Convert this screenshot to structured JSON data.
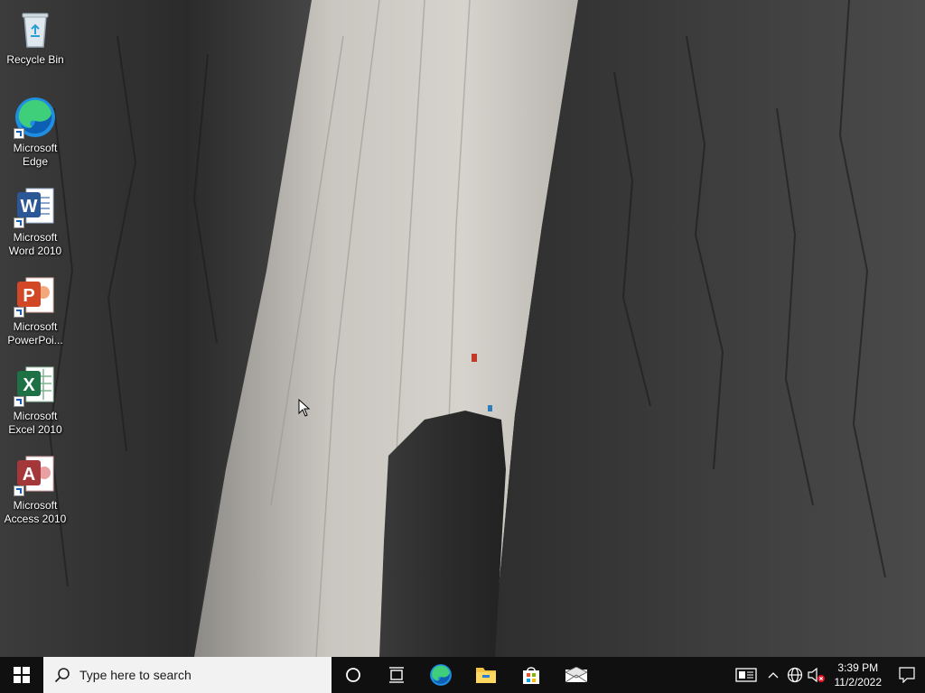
{
  "desktop": {
    "icons": [
      {
        "label": "Recycle Bin",
        "icon": "recycle-bin-icon"
      },
      {
        "label": "Microsoft\nEdge",
        "icon": "edge-icon"
      },
      {
        "label": "Microsoft\nWord 2010",
        "icon": "word-icon",
        "letter": "W"
      },
      {
        "label": "Microsoft\nPowerPoi...",
        "icon": "powerpoint-icon",
        "letter": "P"
      },
      {
        "label": "Microsoft\nExcel 2010",
        "icon": "excel-icon",
        "letter": "X"
      },
      {
        "label": "Microsoft\nAccess 2010",
        "icon": "access-icon",
        "letter": "A"
      }
    ]
  },
  "taskbar": {
    "search_placeholder": "Type here to search",
    "pinned": [
      "cortana-icon",
      "task-view-icon",
      "edge-icon",
      "file-explorer-icon",
      "store-icon",
      "mail-icon"
    ],
    "tray": [
      "news-widget-icon",
      "chevron-up-icon",
      "network-icon",
      "volume-muted-icon"
    ],
    "clock": {
      "time": "3:39 PM",
      "date": "11/2/2022"
    },
    "notification": "notification-icon"
  },
  "colors": {
    "taskbar_bg": "#101010",
    "search_bg": "#f2f2f2",
    "word": "#2b5797",
    "powerpoint": "#d24726",
    "excel": "#1e7145",
    "access": "#a4373a"
  }
}
